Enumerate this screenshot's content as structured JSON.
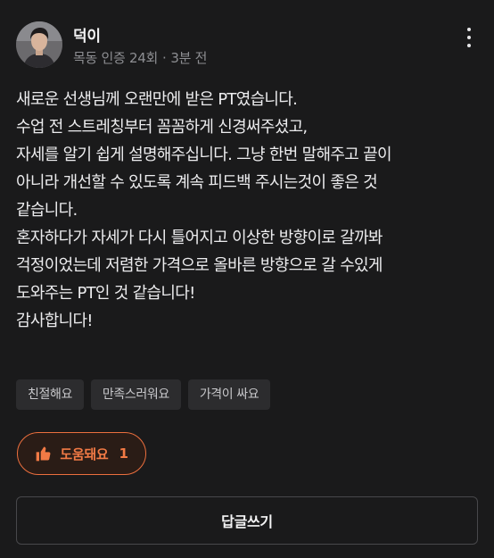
{
  "author": {
    "name": "덕이",
    "location": "목동",
    "verification": "인증 24회",
    "time_ago": "3분 전"
  },
  "review": {
    "lines": [
      "새로운 선생님께 오랜만에 받은 PT였습니다.",
      "수업 전 스트레칭부터 꼼꼼하게 신경써주셨고,",
      "자세를 알기 쉽게 설명해주십니다. 그냥 한번 말해주고 끝이",
      "아니라 개선할 수 있도록 계속 피드백 주시는것이 좋은 것",
      "같습니다.",
      "혼자하다가 자세가 다시 틀어지고 이상한 방향이로 갈까봐",
      "걱정이었는데 저렴한 가격으로 올바른 방향으로 갈 수있게",
      "도와주는 PT인 것 같습니다!",
      "감사합니다!"
    ]
  },
  "tags": [
    "친절해요",
    "만족스러워요",
    "가격이 싸요"
  ],
  "helpful": {
    "label": "도움돼요",
    "count": "1"
  },
  "reply": {
    "label": "답글쓰기"
  },
  "icons": {
    "more": "more-vertical-icon",
    "thumb": "thumbs-up-icon"
  },
  "colors": {
    "background": "#1a1a1b",
    "accent": "#ec6f3e",
    "tag_bg": "#2c2c2e"
  }
}
